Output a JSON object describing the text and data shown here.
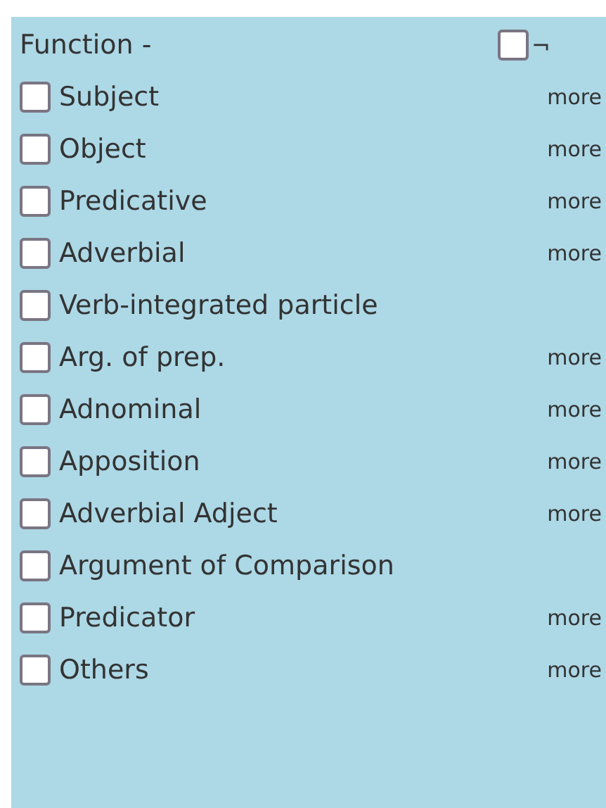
{
  "header": {
    "label": "Function -",
    "negate": {
      "checked": false,
      "symbol": "¬"
    }
  },
  "items": [
    {
      "label": "Subject",
      "checked": false,
      "link": "more"
    },
    {
      "label": "Object",
      "checked": false,
      "link": "more"
    },
    {
      "label": "Predicative",
      "checked": false,
      "link": "more"
    },
    {
      "label": "Adverbial",
      "checked": false,
      "link": "more"
    },
    {
      "label": "Verb-integrated particle",
      "checked": false
    },
    {
      "label": "Arg. of prep.",
      "checked": false,
      "link": "more"
    },
    {
      "label": "Adnominal",
      "checked": false,
      "link": "more"
    },
    {
      "label": "Apposition",
      "checked": false,
      "link": "more"
    },
    {
      "label": "Adverbial Adject",
      "checked": false,
      "link": "more"
    },
    {
      "label": "Argument of Comparison",
      "checked": false
    },
    {
      "label": "Predicator",
      "checked": false,
      "link": "more"
    },
    {
      "label": "Others",
      "checked": false,
      "link": "more"
    }
  ]
}
